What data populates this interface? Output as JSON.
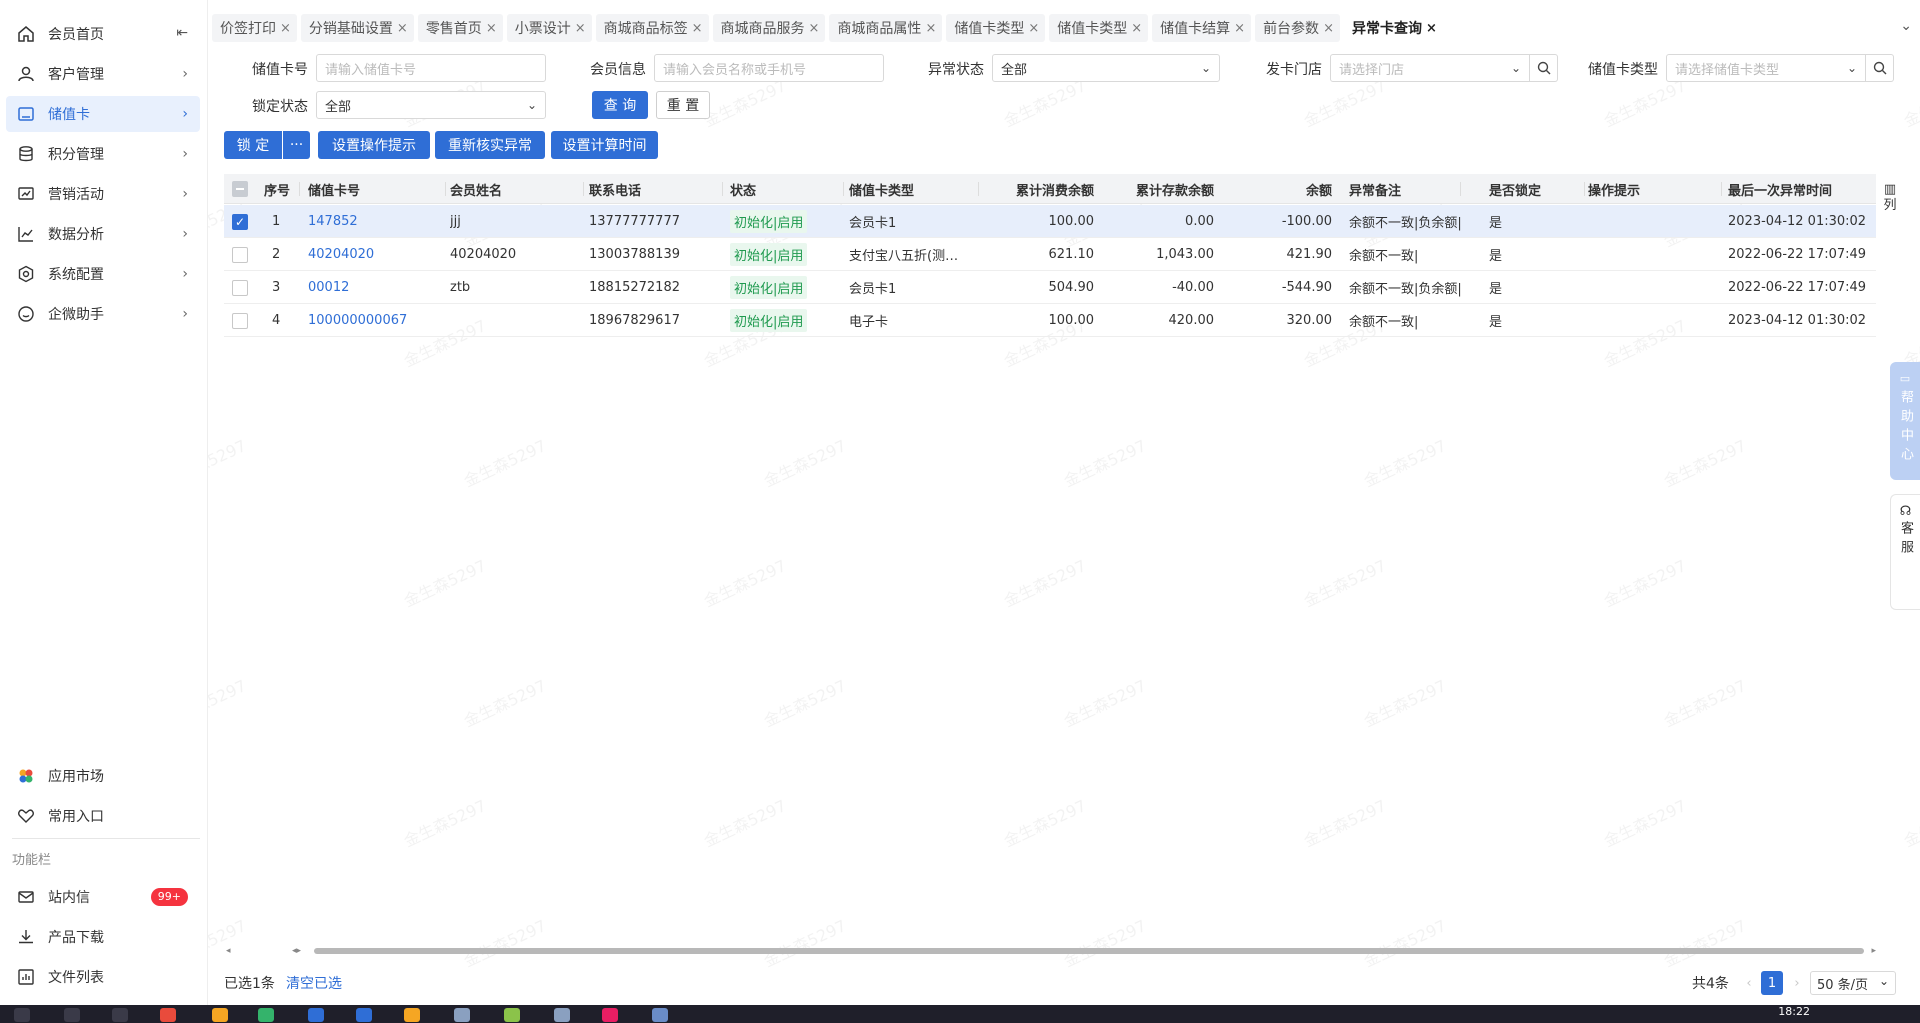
{
  "sidebar": {
    "items": [
      {
        "label": "会员首页",
        "icon": "home-icon"
      },
      {
        "label": "客户管理",
        "icon": "user-icon"
      },
      {
        "label": "储值卡",
        "icon": "card-icon"
      },
      {
        "label": "积分管理",
        "icon": "database-icon"
      },
      {
        "label": "营销活动",
        "icon": "campaign-icon"
      },
      {
        "label": "数据分析",
        "icon": "chart-icon"
      },
      {
        "label": "系统配置",
        "icon": "settings-icon"
      },
      {
        "label": "企微助手",
        "icon": "chat-icon"
      }
    ],
    "bottom_items": [
      {
        "label": "应用市场",
        "icon": "app-market-icon"
      },
      {
        "label": "常用入口",
        "icon": "heart-icon"
      }
    ],
    "section_label": "功能栏",
    "function_items": [
      {
        "label": "站内信",
        "icon": "mail-icon",
        "badge": "99+"
      },
      {
        "label": "产品下载",
        "icon": "download-icon"
      },
      {
        "label": "文件列表",
        "icon": "file-list-icon"
      }
    ]
  },
  "tabs": [
    {
      "label": "价签打印"
    },
    {
      "label": "分销基础设置"
    },
    {
      "label": "零售首页"
    },
    {
      "label": "小票设计"
    },
    {
      "label": "商城商品标签"
    },
    {
      "label": "商城商品服务"
    },
    {
      "label": "商城商品属性"
    },
    {
      "label": "储值卡类型"
    },
    {
      "label": "储值卡类型"
    },
    {
      "label": "储值卡结算"
    },
    {
      "label": "前台参数"
    },
    {
      "label": "异常卡查询",
      "active": true
    }
  ],
  "filters": {
    "card_no": {
      "label": "储值卡号",
      "placeholder": "请输入储值卡号"
    },
    "member_info": {
      "label": "会员信息",
      "placeholder": "请输入会员名称或手机号"
    },
    "abnormal_status": {
      "label": "异常状态",
      "value": "全部"
    },
    "issue_store": {
      "label": "发卡门店",
      "placeholder": "请选择门店"
    },
    "card_type": {
      "label": "储值卡类型",
      "placeholder": "请选择储值卡类型"
    },
    "lock_status": {
      "label": "锁定状态",
      "value": "全部"
    },
    "query_label": "查 询",
    "reset_label": "重 置"
  },
  "actions": {
    "lock_label": "锁 定",
    "more_label": "···",
    "set_tip_label": "设置操作提示",
    "reverify_label": "重新核实异常",
    "set_time_label": "设置计算时间"
  },
  "table": {
    "headers": [
      "序号",
      "储值卡号",
      "会员姓名",
      "联系电话",
      "状态",
      "储值卡类型",
      "累计消费余额",
      "累计存款余额",
      "余额",
      "异常备注",
      "是否锁定",
      "操作提示",
      "最后一次异常时间"
    ],
    "rows": [
      {
        "checked": true,
        "seq": "1",
        "card_no": "147852",
        "name": "jjj",
        "phone": "13777777777",
        "status": "初始化|启用",
        "type": "会员卡1",
        "consume": "100.00",
        "deposit": "0.00",
        "balance": "-100.00",
        "remark": "余额不一致|负余额|",
        "locked": "是",
        "tip": "",
        "last_time": "2023-04-12 01:30:02"
      },
      {
        "checked": false,
        "seq": "2",
        "card_no": "40204020",
        "name": "40204020",
        "phone": "13003788139",
        "status": "初始化|启用",
        "type": "支付宝八五折(测…",
        "consume": "621.10",
        "deposit": "1,043.00",
        "balance": "421.90",
        "remark": "余额不一致|",
        "locked": "是",
        "tip": "",
        "last_time": "2022-06-22 17:07:49"
      },
      {
        "checked": false,
        "seq": "3",
        "card_no": "00012",
        "name": "ztb",
        "phone": "18815272182",
        "status": "初始化|启用",
        "type": "会员卡1",
        "consume": "504.90",
        "deposit": "-40.00",
        "balance": "-544.90",
        "remark": "余额不一致|负余额|",
        "locked": "是",
        "tip": "",
        "last_time": "2022-06-22 17:07:49"
      },
      {
        "checked": false,
        "seq": "4",
        "card_no": "100000000067",
        "name": "",
        "phone": "18967829617",
        "status": "初始化|启用",
        "type": "电子卡",
        "consume": "100.00",
        "deposit": "420.00",
        "balance": "320.00",
        "remark": "余额不一致|",
        "locked": "是",
        "tip": "",
        "last_time": "2023-04-12 01:30:02"
      }
    ],
    "column_setting_label": "列"
  },
  "footer": {
    "selected_text": "已选1条",
    "clear_label": "清空已选",
    "total_text": "共4条",
    "current_page": "1",
    "page_size": "50 条/页"
  },
  "float": {
    "help_label": "帮助中心",
    "service_label": "客服"
  },
  "taskbar": {
    "time": "18:22"
  },
  "watermark": "金生森5297",
  "colors": {
    "accent": "#2f6ed6",
    "status_green": "#1f9a4f",
    "badge_red": "#f5333f"
  }
}
